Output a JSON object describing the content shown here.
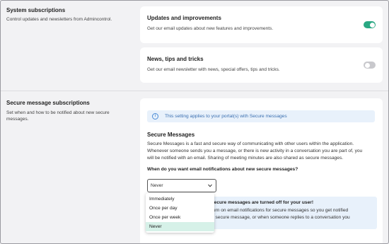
{
  "system": {
    "title": "System subscriptions",
    "description": "Control updates and newsletters from Admincontrol.",
    "cards": [
      {
        "title": "Updates and improvements",
        "description": "Get our email updates about new features and improvements.",
        "enabled": true
      },
      {
        "title": "News, tips and tricks",
        "description": "Get our email newsletter with news, special offers, tips and tricks.",
        "enabled": false
      }
    ]
  },
  "secure": {
    "title": "Secure message subscriptions",
    "description_line1": "Set when and how to be notified about new secure",
    "description_line2": "messages.",
    "info": "This setting applies to your portal(s) with Secure messages",
    "heading": "Secure Messages",
    "body_line1": "Secure Messages is a fast and secure way of communicating with other users within the application.",
    "body_line2": "Whenever someone sends you a message, or there is new activity in a conversation you are part of, you",
    "body_line3": "will be notified with an email. Sharing of meeting minutes are also shared as secure messages.",
    "question": "When do you want email notifications about new secure messages?",
    "selected": "Never",
    "options": [
      "Immediately",
      "Once per day",
      "Once per week",
      "Never"
    ],
    "notice_title": "secure messages are turned off for your user!",
    "notice_line1": "turn on email notifications for secure messages so you get notified",
    "notice_line2": "a secure message, or when someone replies to a conversation you"
  },
  "colors": {
    "accent": "#2aa883",
    "toggle_off": "#c8c8cc",
    "info_bg": "#e8f1fb",
    "selected_bg": "#d6f1e8"
  },
  "icons": {
    "info": "info-icon",
    "chevron": "chevron-down-icon"
  }
}
